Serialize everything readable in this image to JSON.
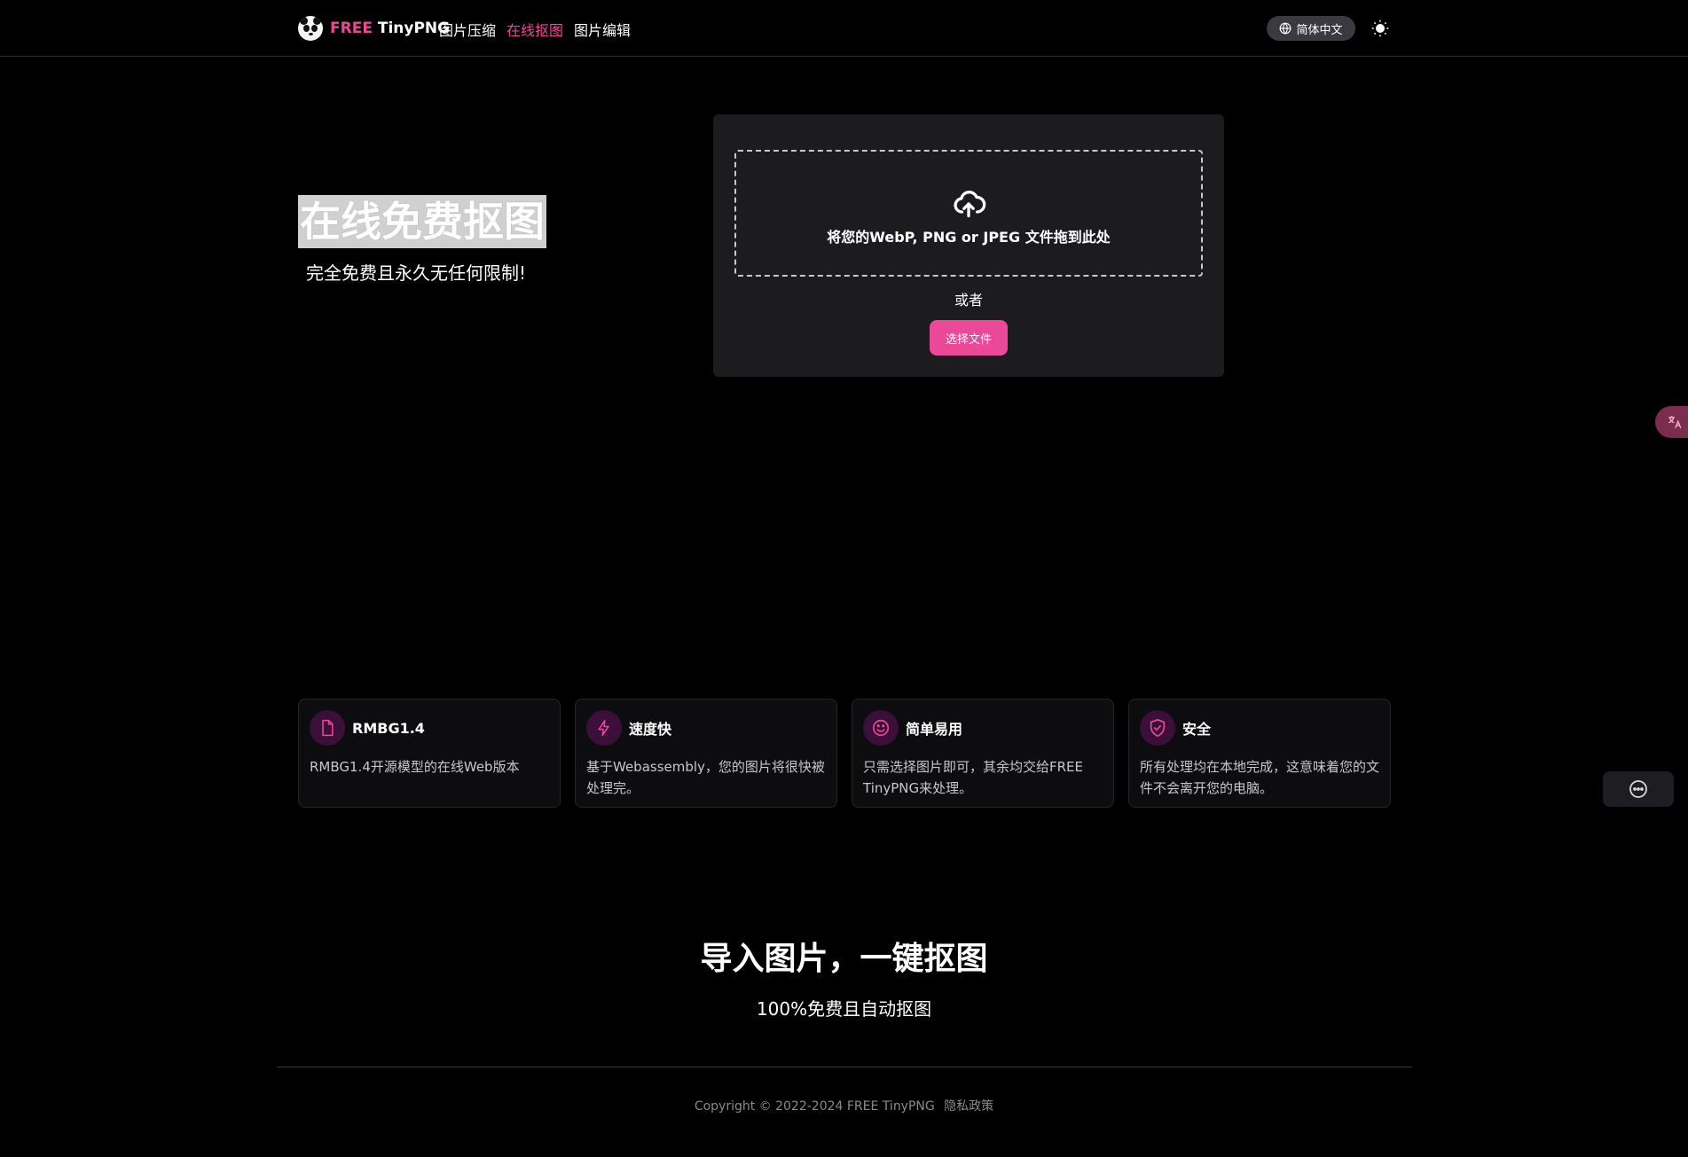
{
  "header": {
    "brand_free": "FREE",
    "brand_name": "TinyPNG",
    "nav": [
      {
        "label": "图片压缩",
        "active": false
      },
      {
        "label": "在线抠图",
        "active": true
      },
      {
        "label": "图片编辑",
        "active": false
      }
    ],
    "language_label": "简体中文",
    "language_icon": "globe-icon",
    "theme_icon": "sun-icon"
  },
  "hero": {
    "title": "在线免费抠图",
    "subtitle": "完全免费且永久无任何限制!"
  },
  "upload": {
    "icon": "cloud-upload-icon",
    "drop_text": "将您的WebP, PNG or JPEG 文件拖到此处",
    "or_text": "或者",
    "choose_button": "选择文件"
  },
  "features": [
    {
      "icon": "file-icon",
      "title": "RMBG1.4",
      "desc": "RMBG1.4开源模型的在线Web版本"
    },
    {
      "icon": "lightning-icon",
      "title": "速度快",
      "desc": "基于Webassembly，您的图片将很快被处理完。"
    },
    {
      "icon": "smile-icon",
      "title": "简单易用",
      "desc": "只需选择图片即可，其余均交给FREE TinyPNG来处理。"
    },
    {
      "icon": "shield-check-icon",
      "title": "安全",
      "desc": "所有处理均在本地完成，这意味着您的文件不会离开您的电脑。"
    }
  ],
  "cta": {
    "title": "导入图片，一键抠图",
    "subtitle": "100%免费且自动抠图"
  },
  "footer": {
    "copyright": "Copyright © 2022-2024 FREE TinyPNG",
    "privacy": "隐私政策"
  },
  "floating": {
    "translate_icon": "translate-icon",
    "chat_icon": "chat-bubble-icon"
  },
  "colors": {
    "accent": "#ec4899",
    "background": "#000000",
    "card": "#1c1c1f"
  }
}
